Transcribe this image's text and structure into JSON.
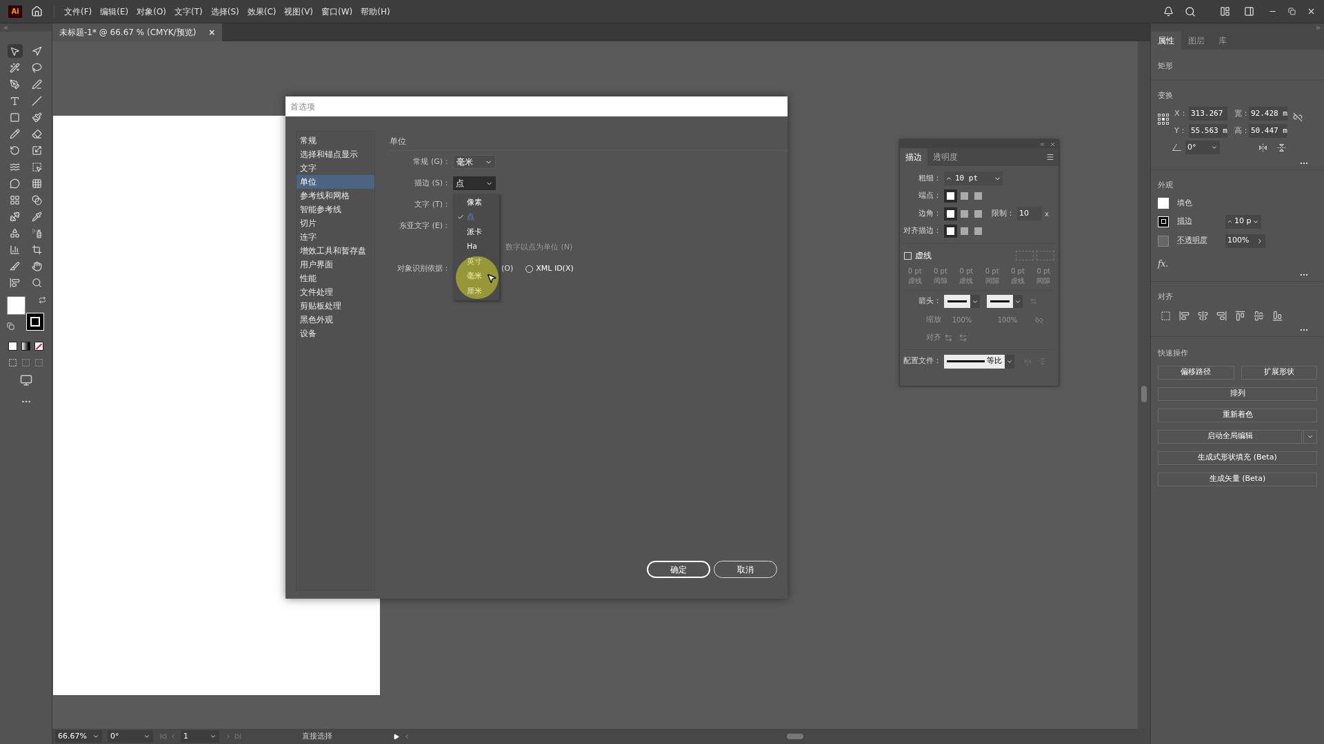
{
  "app_bar": {
    "logo": "Ai",
    "menus": [
      "文件(F)",
      "编辑(E)",
      "对象(O)",
      "文字(T)",
      "选择(S)",
      "效果(C)",
      "视图(V)",
      "窗口(W)",
      "帮助(H)"
    ]
  },
  "document_tab": {
    "title": "未标题-1* @ 66.67 % (CMYK/预览)",
    "close": "×"
  },
  "preferences_dialog": {
    "title": "首选项",
    "categories": [
      {
        "label": "常规",
        "selected": false
      },
      {
        "label": "选择和锚点显示",
        "selected": false
      },
      {
        "label": "文字",
        "selected": false
      },
      {
        "label": "单位",
        "selected": true
      },
      {
        "label": "参考线和网格",
        "selected": false
      },
      {
        "label": "智能参考线",
        "selected": false
      },
      {
        "label": "切片",
        "selected": false
      },
      {
        "label": "连字",
        "selected": false
      },
      {
        "label": "增效工具和暂存盘",
        "selected": false
      },
      {
        "label": "用户界面",
        "selected": false
      },
      {
        "label": "性能",
        "selected": false
      },
      {
        "label": "文件处理",
        "selected": false
      },
      {
        "label": "剪贴板处理",
        "selected": false
      },
      {
        "label": "黑色外观",
        "selected": false
      },
      {
        "label": "设备",
        "selected": false
      }
    ],
    "section_title": "单位",
    "fields": [
      {
        "label": "常规 (G)：",
        "value": "毫米",
        "focused": false
      },
      {
        "label": "描边 (S)：",
        "value": "点",
        "focused": true
      },
      {
        "label": "文字 (T)："
      },
      {
        "label": "东亚文字 (E)："
      }
    ],
    "hint": "数字以点为单位 (N)",
    "object_id": {
      "label": "对象识别依据：",
      "partial_option": "(O)",
      "option": {
        "label": "XML ID(X)",
        "selected": false
      }
    },
    "dropdown": [
      {
        "label": "像素",
        "checked": false,
        "hovered": false
      },
      {
        "label": "点",
        "checked": true,
        "hovered": false
      },
      {
        "label": "派卡",
        "checked": false,
        "hovered": false
      },
      {
        "label": "Ha",
        "checked": false,
        "hovered": false
      },
      {
        "label": "英寸",
        "checked": false,
        "hovered": false
      },
      {
        "label": "毫米",
        "checked": false,
        "hovered": true
      },
      {
        "label": "厘米",
        "checked": false,
        "hovered": false
      }
    ],
    "buttons": [
      {
        "label": "确定",
        "default": true
      },
      {
        "label": "取消",
        "default": false
      }
    ]
  },
  "stroke_panel": {
    "tabs": [
      {
        "label": "描边",
        "selected": true
      },
      {
        "label": "透明度",
        "selected": false
      }
    ],
    "weight_label": "粗细：",
    "weight": "10 pt",
    "cap_label": "端点：",
    "caps": [
      {
        "selected": true
      },
      {
        "selected": false
      },
      {
        "selected": false
      }
    ],
    "corner_label": "边角：",
    "corners": [
      {
        "selected": true
      },
      {
        "selected": false
      },
      {
        "selected": false
      }
    ],
    "limit_label": "限制：",
    "limit": "10",
    "limit_unit": "x",
    "align_label": "对齐描边：",
    "aligns": [
      {
        "selected": true
      },
      {
        "selected": false
      },
      {
        "selected": false
      }
    ],
    "dashed": {
      "label": "虚线",
      "checked": false
    },
    "dash_values": [
      "0 pt",
      "0 pt",
      "0 pt",
      "0 pt",
      "0 pt",
      "0 pt"
    ],
    "dash_captions": [
      "虚线",
      "间隙",
      "虚线",
      "间隙",
      "虚线",
      "间隙"
    ],
    "arrow_label": "箭头：",
    "scale_label": "缩放",
    "scales": [
      "100%",
      "100%"
    ],
    "arrow_align_label": "对齐",
    "profile_label": "配置文件：",
    "profile": "等比"
  },
  "properties_panel": {
    "tabs": [
      {
        "label": "属性",
        "selected": true
      },
      {
        "label": "图层",
        "selected": false
      },
      {
        "label": "库",
        "selected": false
      }
    ],
    "object_type": "矩形",
    "transform": {
      "title": "变换",
      "fields": [
        {
          "label": "X：",
          "value": "313.267"
        },
        {
          "label": "宽：",
          "value": "92.428 m"
        },
        {
          "label": "Y：",
          "value": "55.563 m"
        },
        {
          "label": "高：",
          "value": "50.447 m"
        }
      ],
      "angle": "0°"
    },
    "appearance": {
      "title": "外观",
      "fill": "填色",
      "stroke": "描边",
      "stroke_weight": "10 p",
      "opacity": "不透明度",
      "opacity_value": "100%",
      "fx": "fx."
    },
    "align_title": "对齐",
    "quick_actions": {
      "title": "快速操作",
      "buttons": [
        {
          "label": "偏移路径",
          "kind": "half"
        },
        {
          "label": "扩展形状",
          "kind": "half"
        },
        {
          "label": "排列",
          "kind": "full"
        },
        {
          "label": "重新着色",
          "kind": "full"
        },
        {
          "label": "启动全局编辑",
          "kind": "split"
        },
        {
          "label": "生成式形状填充 (Beta)",
          "kind": "full"
        },
        {
          "label": "生成矢量 (Beta)",
          "kind": "full"
        }
      ]
    }
  },
  "status_bar": {
    "zoom": "66.67%",
    "rotation": "0°",
    "artboard": "1",
    "tool": "直接选择"
  }
}
